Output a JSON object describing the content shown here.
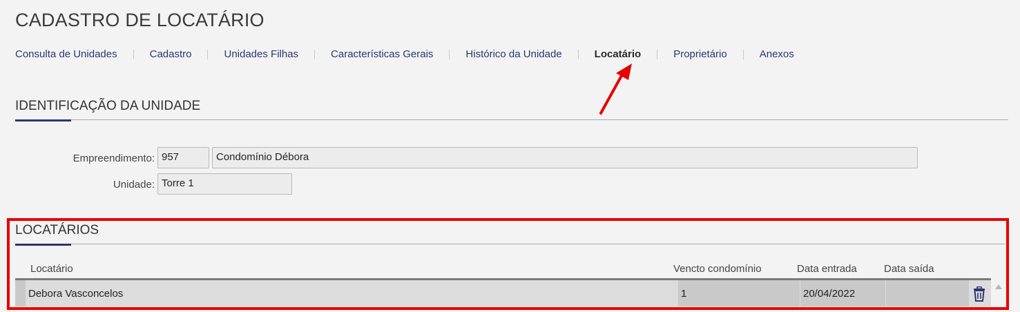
{
  "page": {
    "title": "CADASTRO DE LOCATÁRIO"
  },
  "tabs": [
    {
      "label": "Consulta de Unidades"
    },
    {
      "label": "Cadastro"
    },
    {
      "label": "Unidades Filhas"
    },
    {
      "label": "Características Gerais"
    },
    {
      "label": "Histórico da Unidade"
    },
    {
      "label": "Locatário",
      "active": true
    },
    {
      "label": "Proprietário"
    },
    {
      "label": "Anexos"
    }
  ],
  "identificacao": {
    "title": "IDENTIFICAÇÃO DA UNIDADE",
    "empreendimento_label": "Empreendimento:",
    "empreendimento_code": "957",
    "empreendimento_name": "Condomínio Débora",
    "unidade_label": "Unidade:",
    "unidade_value": "Torre 1"
  },
  "locatarios": {
    "title": "LOCATÁRIOS",
    "columns": {
      "locatario": "Locatário",
      "vencto": "Vencto condomínio",
      "entrada": "Data entrada",
      "saida": "Data saída"
    },
    "rows": [
      {
        "locatario": "Debora Vasconcelos",
        "vencto": "1",
        "entrada": "20/04/2022",
        "saida": ""
      }
    ]
  },
  "colors": {
    "accent": "#2b3572",
    "highlight": "#e60000",
    "annotation_arrow": "#e60000"
  },
  "icons": [
    "red-arrow-annotation-icon",
    "trash-icon",
    "scroll-up-icon"
  ]
}
